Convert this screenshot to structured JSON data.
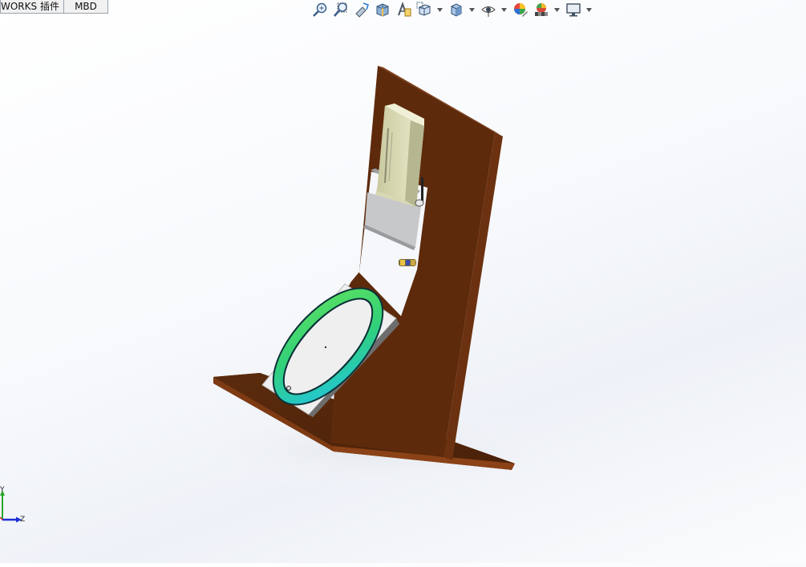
{
  "tabs": [
    {
      "label": "WORKS 插件"
    },
    {
      "label": "MBD"
    }
  ],
  "toolbar": {
    "icons": [
      "zoom-to-fit-icon",
      "zoom-to-area-icon",
      "previous-view-icon",
      "section-view-icon",
      "dynamic-annotation-view-icon",
      "view-orientation-icon",
      "display-style-icon",
      "hide-show-items-icon",
      "edit-appearance-icon",
      "apply-scene-icon",
      "view-settings-icon"
    ]
  },
  "triad": {
    "y_label": "Y",
    "z_label": "Z"
  },
  "colors": {
    "wood": "#5a2a0c",
    "wood_side": "#7a3a14",
    "plate": "#f0f0f0",
    "ring_green": "#3ddc60",
    "ring_cyan": "#27c8d8",
    "axis_green": "#2aa52a",
    "axis_blue": "#1d2fd6"
  }
}
